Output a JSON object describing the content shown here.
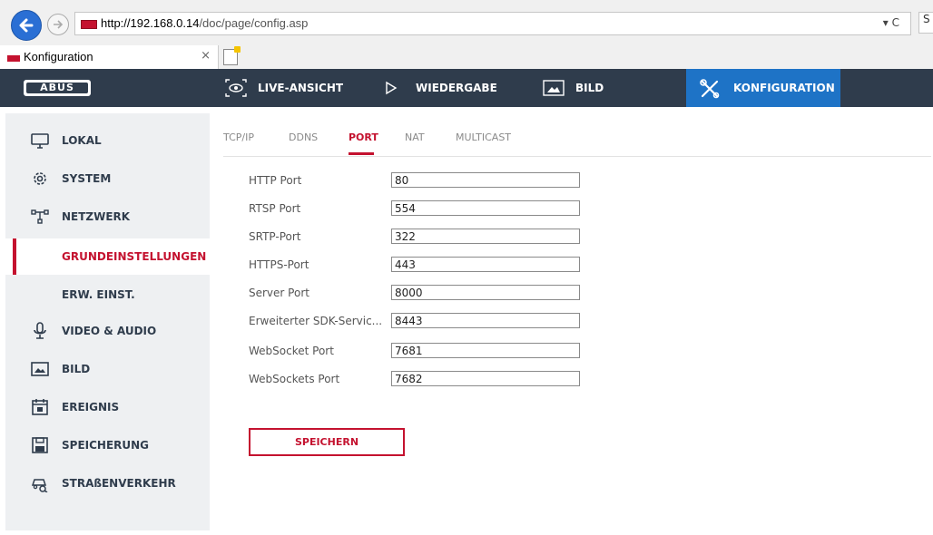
{
  "browser": {
    "url_host": "http://192.168.0.14",
    "url_path": "/doc/page/config.asp",
    "url_controls": "▾ C",
    "edge_glyph": "S",
    "tab_title": "Konfiguration",
    "tab_close": "×"
  },
  "app": {
    "logo": "ABUS",
    "accent_color": "#c4122f",
    "active_nav_color": "#1e73c6",
    "topnav": {
      "live": "LIVE-ANSICHT",
      "playback": "WIEDERGABE",
      "image": "BILD",
      "config": "KONFIGURATION"
    }
  },
  "sidebar": {
    "items": [
      {
        "label": "LOKAL",
        "icon": "monitor-icon"
      },
      {
        "label": "SYSTEM",
        "icon": "gear-icon"
      },
      {
        "label": "NETZWERK",
        "icon": "network-icon"
      },
      {
        "label": "GRUNDEINSTELLUNGEN",
        "icon": "",
        "active": true
      },
      {
        "label": "ERW. EINST.",
        "icon": ""
      },
      {
        "label": "VIDEO & AUDIO",
        "icon": "microphone-icon"
      },
      {
        "label": "BILD",
        "icon": "image-icon"
      },
      {
        "label": "EREIGNIS",
        "icon": "calendar-icon"
      },
      {
        "label": "SPEICHERUNG",
        "icon": "floppy-icon"
      },
      {
        "label": "STRAßENVERKEHR",
        "icon": "car-search-icon"
      }
    ]
  },
  "subtabs": {
    "items": [
      "TCP/IP",
      "DDNS",
      "PORT",
      "NAT",
      "MULTICAST"
    ],
    "active": "PORT"
  },
  "form": {
    "fields": [
      {
        "label": "HTTP Port",
        "value": "80"
      },
      {
        "label": "RTSP Port",
        "value": "554"
      },
      {
        "label": "SRTP-Port",
        "value": "322"
      },
      {
        "label": "HTTPS-Port",
        "value": "443"
      },
      {
        "label": "Server Port",
        "value": "8000"
      },
      {
        "label": "Erweiterter SDK-Servic...",
        "value": "8443"
      },
      {
        "label": "WebSocket Port",
        "value": "7681"
      },
      {
        "label": "WebSockets Port",
        "value": "7682"
      }
    ],
    "save_label": "SPEICHERN"
  }
}
